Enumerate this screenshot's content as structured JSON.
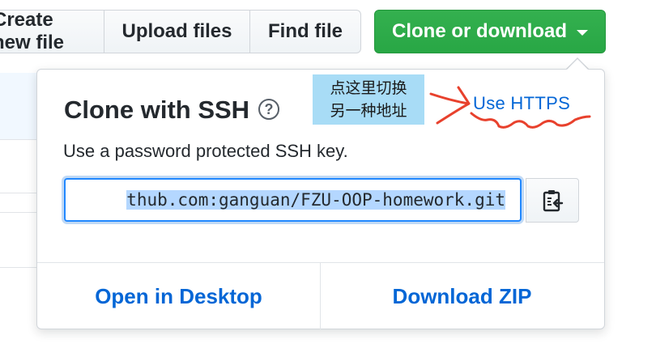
{
  "toolbar": {
    "create_label": "Create new file",
    "upload_label": "Upload files",
    "find_label": "Find file",
    "clone_label": "Clone or download"
  },
  "clone_panel": {
    "title": "Clone with SSH",
    "help_icon": "question-circle-icon",
    "switch_link": "Use HTTPS",
    "description": "Use a password protected SSH key.",
    "url_value": "git@github.com:ganguan/FZU-OOP-homework.git",
    "url_visible": "thub.com:ganguan/FZU-OOP-homework.git",
    "copy_icon": "clipboard-icon",
    "open_desktop_label": "Open in Desktop",
    "download_zip_label": "Download ZIP"
  },
  "annotation": {
    "line1": "点这里切换",
    "line2": "另一种地址",
    "color": "#e8412d"
  },
  "colors": {
    "accent": "#28a745",
    "link": "#0366d6",
    "note_bg": "#a8dcf6"
  }
}
